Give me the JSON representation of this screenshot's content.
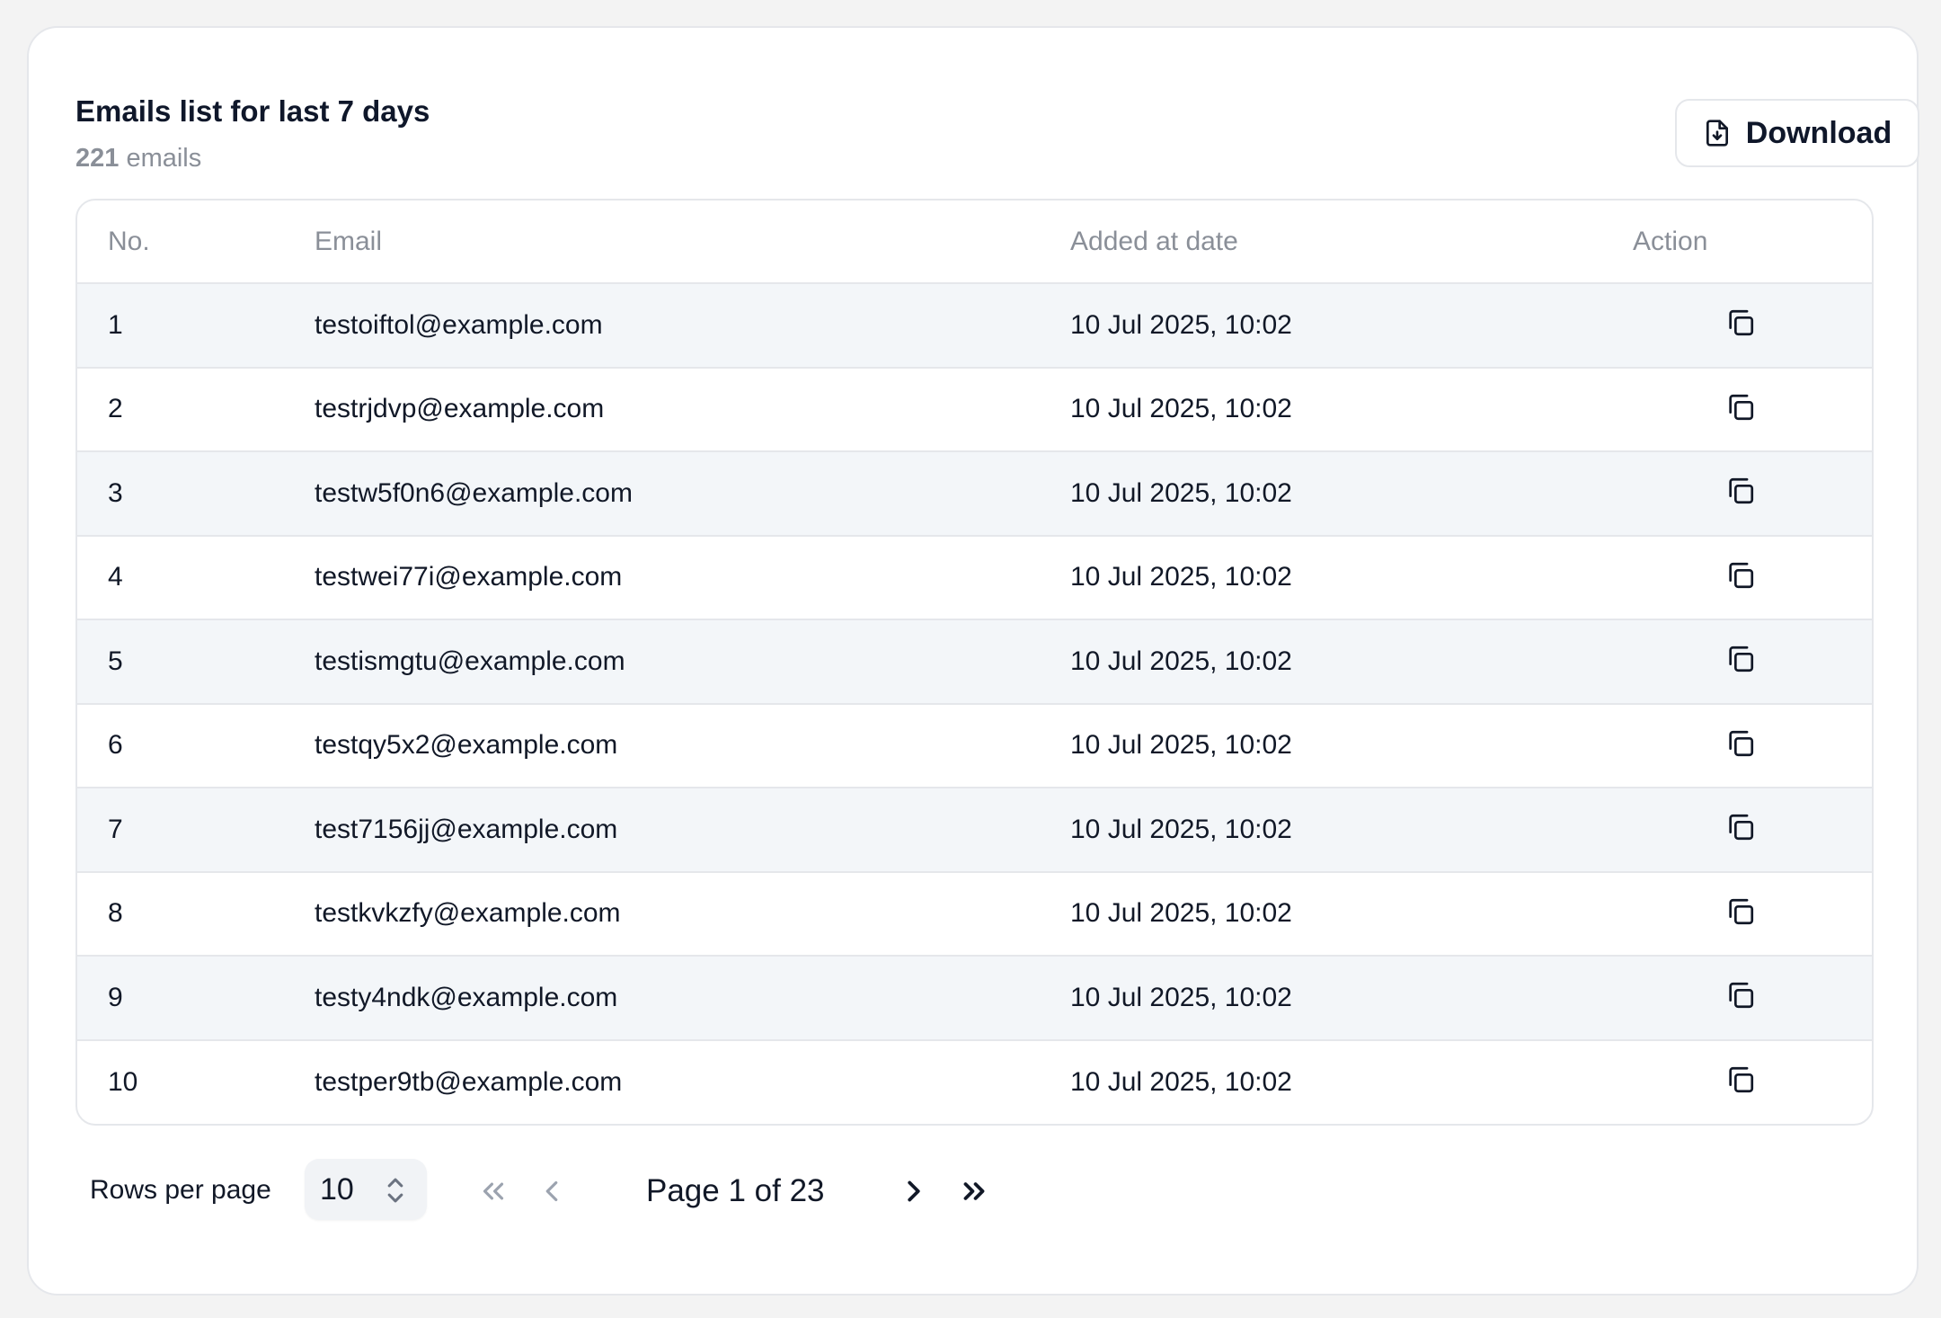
{
  "header": {
    "title": "Emails list for last 7 days",
    "count": "221",
    "count_suffix": " emails",
    "download_label": "Download"
  },
  "table": {
    "columns": [
      "No.",
      "Email",
      "Added at date",
      "Action"
    ],
    "rows": [
      {
        "no": "1",
        "email": "testoiftol@example.com",
        "date": "10 Jul 2025, 10:02"
      },
      {
        "no": "2",
        "email": "testrjdvp@example.com",
        "date": "10 Jul 2025, 10:02"
      },
      {
        "no": "3",
        "email": "testw5f0n6@example.com",
        "date": "10 Jul 2025, 10:02"
      },
      {
        "no": "4",
        "email": "testwei77i@example.com",
        "date": "10 Jul 2025, 10:02"
      },
      {
        "no": "5",
        "email": "testismgtu@example.com",
        "date": "10 Jul 2025, 10:02"
      },
      {
        "no": "6",
        "email": "testqy5x2@example.com",
        "date": "10 Jul 2025, 10:02"
      },
      {
        "no": "7",
        "email": "test7156jj@example.com",
        "date": "10 Jul 2025, 10:02"
      },
      {
        "no": "8",
        "email": "testkvkzfy@example.com",
        "date": "10 Jul 2025, 10:02"
      },
      {
        "no": "9",
        "email": "testy4ndk@example.com",
        "date": "10 Jul 2025, 10:02"
      },
      {
        "no": "10",
        "email": "testper9tb@example.com",
        "date": "10 Jul 2025, 10:02"
      }
    ],
    "action_icon": "copy-icon"
  },
  "pagination": {
    "rows_per_page_label": "Rows per page",
    "rows_per_page_value": "10",
    "page_text": "Page 1 of 23",
    "icons": [
      "chevrons-left-icon",
      "chevron-left-icon",
      "chevron-right-icon",
      "chevrons-right-icon"
    ]
  },
  "colors": {
    "background": "#f3f3f3",
    "card": "#ffffff",
    "row_shade": "#f3f6f9",
    "border": "#e5e7eb",
    "muted_text": "#8a8f98",
    "text": "#111827",
    "disabled_icon": "#9ca3af"
  }
}
